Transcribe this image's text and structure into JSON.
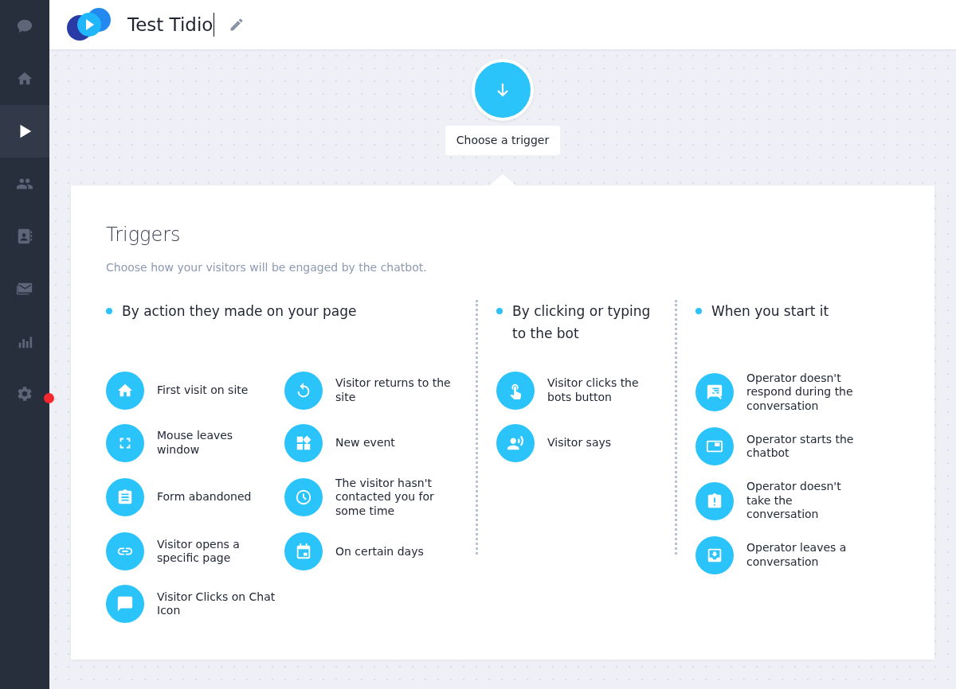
{
  "sidebar": {
    "items": [
      {
        "selected": false,
        "notification": false
      },
      {
        "selected": false,
        "notification": false
      },
      {
        "selected": true,
        "notification": false
      },
      {
        "selected": false,
        "notification": false
      },
      {
        "selected": false,
        "notification": false
      },
      {
        "selected": false,
        "notification": false
      },
      {
        "selected": false,
        "notification": false
      },
      {
        "selected": false,
        "notification": true
      }
    ]
  },
  "header": {
    "title": "Test Tidio",
    "editing": true
  },
  "start_node": {
    "label": "Choose a trigger"
  },
  "panel": {
    "title": "Triggers",
    "subtitle": "Choose how your visitors will be engaged by the chatbot.",
    "groups": [
      {
        "title": "By action they made on your page",
        "items": [
          {
            "label": "First visit on site"
          },
          {
            "label": "Visitor returns to the site"
          },
          {
            "label": "Mouse leaves window"
          },
          {
            "label": "New event"
          },
          {
            "label": "Form abandoned"
          },
          {
            "label": "The visitor hasn't contacted you for some time"
          },
          {
            "label": "Visitor opens a specific page"
          },
          {
            "label": "On certain days"
          },
          {
            "label": "Visitor Clicks on Chat Icon"
          }
        ]
      },
      {
        "title": "By clicking or typing to the bot",
        "items": [
          {
            "label": "Visitor clicks the bots button"
          },
          {
            "label": "Visitor says"
          }
        ]
      },
      {
        "title": "When you start it",
        "items": [
          {
            "label": "Operator doesn't respond during the conversation"
          },
          {
            "label": "Operator starts the chatbot"
          },
          {
            "label": "Operator doesn't take the conversation"
          },
          {
            "label": "Operator leaves a conversation"
          }
        ]
      }
    ]
  }
}
